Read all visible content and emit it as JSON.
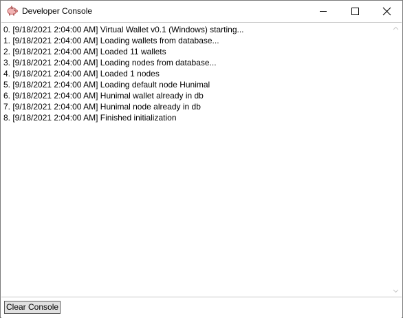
{
  "window": {
    "title": "Developer Console",
    "icon": "piggy-bank-icon"
  },
  "caption_buttons": {
    "minimize": "minimize-icon",
    "maximize": "maximize-icon",
    "close": "close-icon"
  },
  "console": {
    "lines": [
      "0. [9/18/2021 2:04:00 AM] Virtual Wallet v0.1 (Windows) starting...",
      "1. [9/18/2021 2:04:00 AM] Loading wallets from database...",
      "2. [9/18/2021 2:04:00 AM] Loaded 11 wallets",
      "3. [9/18/2021 2:04:00 AM] Loading nodes from database...",
      "4. [9/18/2021 2:04:00 AM] Loaded 1 nodes",
      "5. [9/18/2021 2:04:00 AM] Loading default node Hunimal",
      "6. [9/18/2021 2:04:00 AM] Hunimal wallet already in db",
      "7. [9/18/2021 2:04:00 AM] Hunimal node already in db",
      "8. [9/18/2021 2:04:00 AM] Finished initialization"
    ]
  },
  "footer": {
    "clear_label": "Clear Console"
  },
  "colors": {
    "window_border": "#7a7a7a",
    "button_face": "#e1e1e1",
    "icon_pink": "#e58a8a"
  }
}
